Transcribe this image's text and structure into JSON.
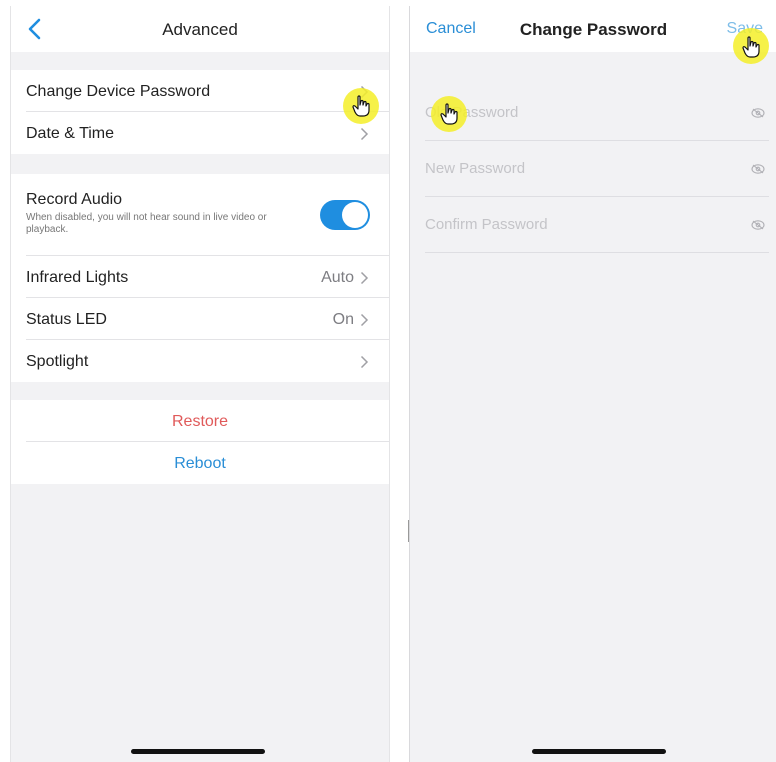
{
  "left": {
    "title": "Advanced",
    "items": {
      "change_password": "Change Device Password",
      "date_time": "Date & Time",
      "record_audio": "Record Audio",
      "record_audio_desc": "When disabled, you will not hear sound in live video or playback.",
      "infrared": "Infrared Lights",
      "infrared_value": "Auto",
      "status_led": "Status LED",
      "status_led_value": "On",
      "spotlight": "Spotlight",
      "restore": "Restore",
      "reboot": "Reboot"
    },
    "record_audio_enabled": true
  },
  "right": {
    "cancel": "Cancel",
    "title": "Change Password",
    "save": "Save",
    "fields": {
      "old": "Old Password",
      "new": "New Password",
      "confirm": "Confirm Password"
    }
  },
  "colors": {
    "accent": "#1f8ee0",
    "link": "#2a8ed6",
    "destructive": "#e05a5a",
    "cursor_highlight": "#f5ee28"
  },
  "icons": [
    "back-chevron-icon",
    "chevron-right-icon",
    "eye-slash-icon",
    "hand-cursor-icon"
  ]
}
